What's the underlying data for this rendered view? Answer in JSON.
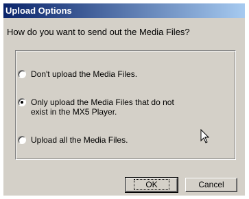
{
  "dialog": {
    "title": "Upload Options",
    "prompt": "How do you want to send out the Media Files?",
    "options": [
      {
        "label": "Don't upload the Media Files.",
        "checked": false
      },
      {
        "label": "Only upload the Media Files that do not\nexist in the MX5 Player.",
        "checked": true
      },
      {
        "label": "Upload all the Media Files.",
        "checked": false
      }
    ],
    "ok_label": "OK",
    "cancel_label": "Cancel"
  },
  "icons": {
    "cursor": "mouse-pointer-icon"
  },
  "colors": {
    "face": "#d4d0c8",
    "title_start": "#0a246a",
    "title_end": "#a6caf0"
  }
}
